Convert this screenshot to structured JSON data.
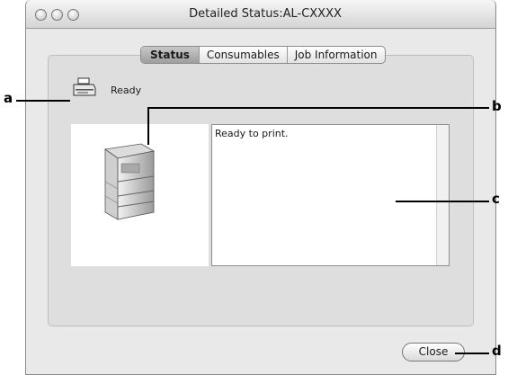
{
  "window": {
    "title": "Detailed Status:AL-CXXXX"
  },
  "tabs": [
    {
      "label": "Status",
      "active": true
    },
    {
      "label": "Consumables",
      "active": false
    },
    {
      "label": "Job Information",
      "active": false
    }
  ],
  "status": {
    "label": "Ready",
    "icon": "printer-icon",
    "message": "Ready to print."
  },
  "buttons": {
    "close_label": "Close"
  },
  "callouts": {
    "a": "a",
    "b": "b",
    "c": "c",
    "d": "d"
  }
}
